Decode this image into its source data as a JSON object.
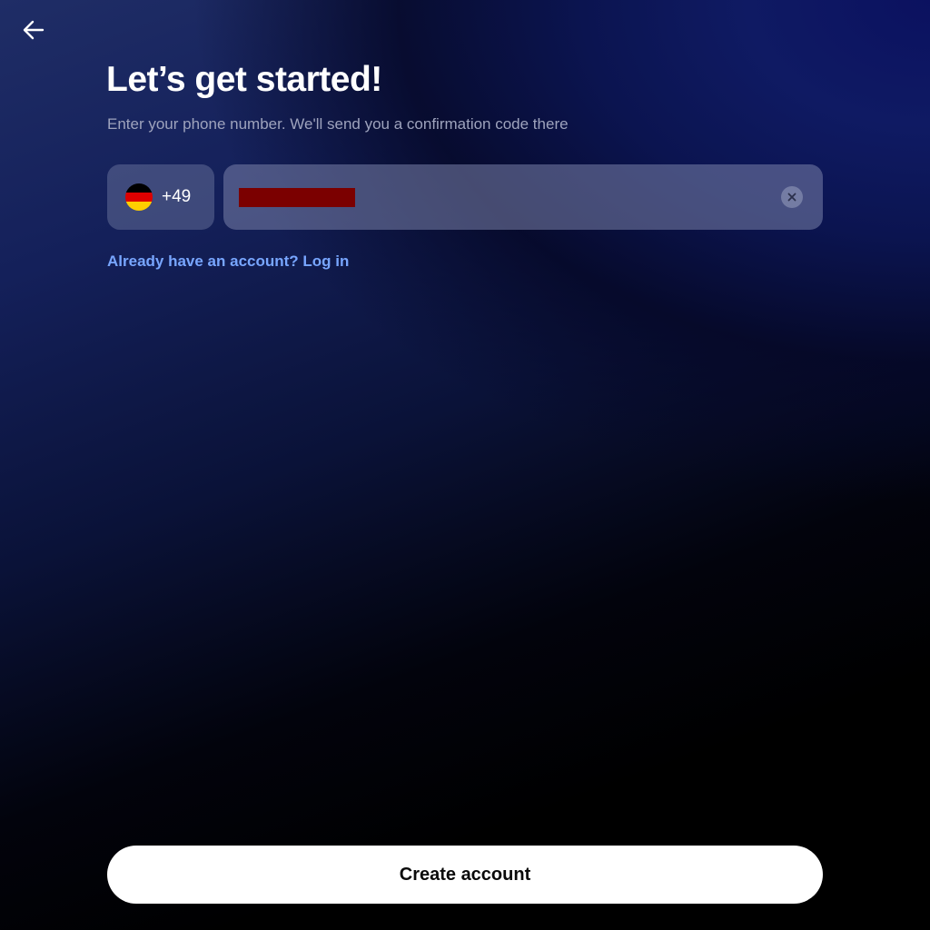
{
  "header": {
    "back_icon": "arrow-left-icon",
    "title": "Let’s get started!",
    "subtitle": "Enter your phone number. We'll send you a confirmation code there"
  },
  "phone_form": {
    "country": {
      "flag_icon": "germany-flag-icon",
      "flag_colors": [
        "#000000",
        "#dd0000",
        "#ffce00"
      ],
      "dial_code": "+49"
    },
    "phone_value_redacted": true,
    "redaction_color": "#7b0000",
    "clear_icon": "close-circle-icon"
  },
  "login_link": {
    "label": "Already have an account? Log in",
    "color": "#78a6ff"
  },
  "primary_action": {
    "label": "Create account"
  }
}
